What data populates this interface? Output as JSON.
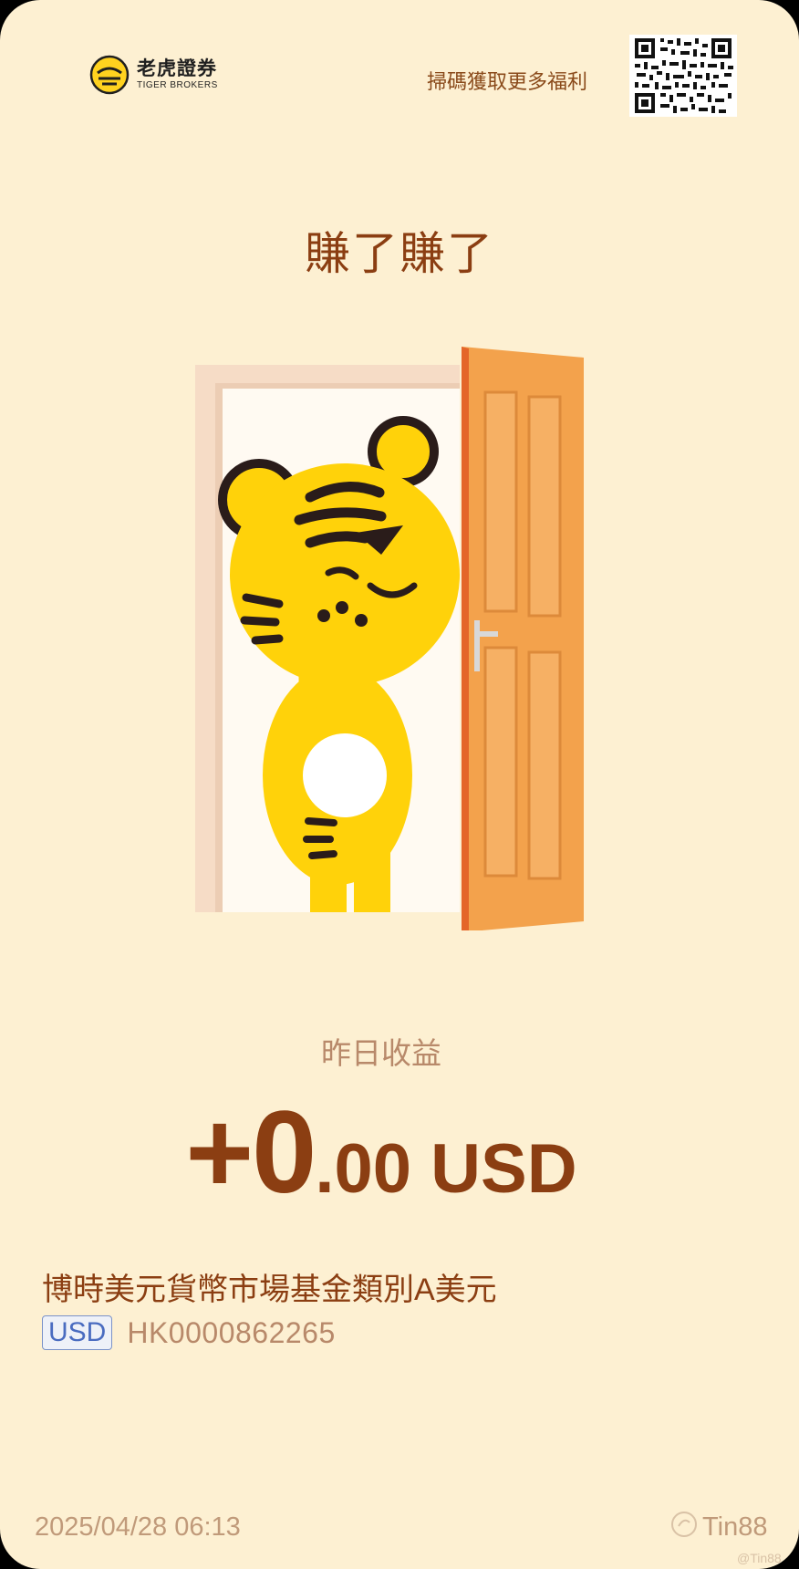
{
  "header": {
    "logo_cn": "老虎證券",
    "logo_en": "TIGER BROKERS",
    "scan_text": "掃碼獲取更多福利"
  },
  "headline": "賺了賺了",
  "earnings": {
    "label": "昨日收益",
    "amount_main": "+0",
    "amount_fraction": ".00",
    "currency": " USD"
  },
  "fund": {
    "name": "博時美元貨幣市場基金類別A美元",
    "currency_badge": "USD",
    "code": "HK0000862265"
  },
  "footer": {
    "timestamp": "2025/04/28 06:13",
    "author": "Tin88",
    "watermark": "@Tin88"
  },
  "colors": {
    "background": "#fdf0d2",
    "primary_text": "#8b3e12",
    "secondary_text": "#b8896a",
    "badge_blue": "#4a6cc0"
  }
}
